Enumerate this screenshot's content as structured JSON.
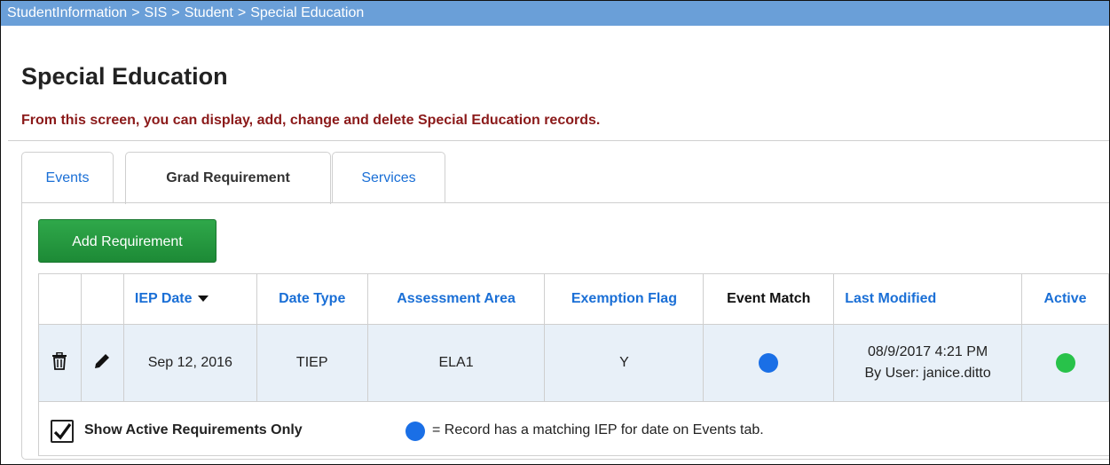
{
  "breadcrumb": [
    "StudentInformation",
    "SIS",
    "Student",
    "Special Education"
  ],
  "breadcrumb_separator": ">",
  "page": {
    "title": "Special Education",
    "subtitle": "From this screen, you can display, add, change and delete Special Education records."
  },
  "tabs": [
    {
      "label": "Events",
      "active": false
    },
    {
      "label": "Grad Requirement",
      "active": true
    },
    {
      "label": "Services",
      "active": false
    }
  ],
  "add_button": "Add Requirement",
  "table": {
    "headers": {
      "iep_date": "IEP Date",
      "date_type": "Date Type",
      "assessment_area": "Assessment Area",
      "exemption_flag": "Exemption Flag",
      "event_match": "Event Match",
      "last_modified": "Last Modified",
      "active": "Active"
    },
    "rows": [
      {
        "iep_date": "Sep 12, 2016",
        "date_type": "TIEP",
        "assessment_area": "ELA1",
        "exemption_flag": "Y",
        "event_match": "blue-dot",
        "last_modified_line1": "08/9/2017 4:21 PM",
        "last_modified_line2": "By User: janice.ditto",
        "active": "green-dot"
      }
    ]
  },
  "footer": {
    "show_active_label": "Show Active Requirements Only",
    "show_active_checked": true,
    "legend_text": "= Record has a matching IEP for date on Events tab."
  },
  "colors": {
    "breadcrumb_bg": "#6a9fd8",
    "link_blue": "#1a6fd6",
    "subtitle_red": "#8b1a1a",
    "button_green": "#1d8a36",
    "row_bg": "#e8f0f8",
    "dot_blue": "#1a6fe6",
    "dot_green": "#28c24a"
  }
}
